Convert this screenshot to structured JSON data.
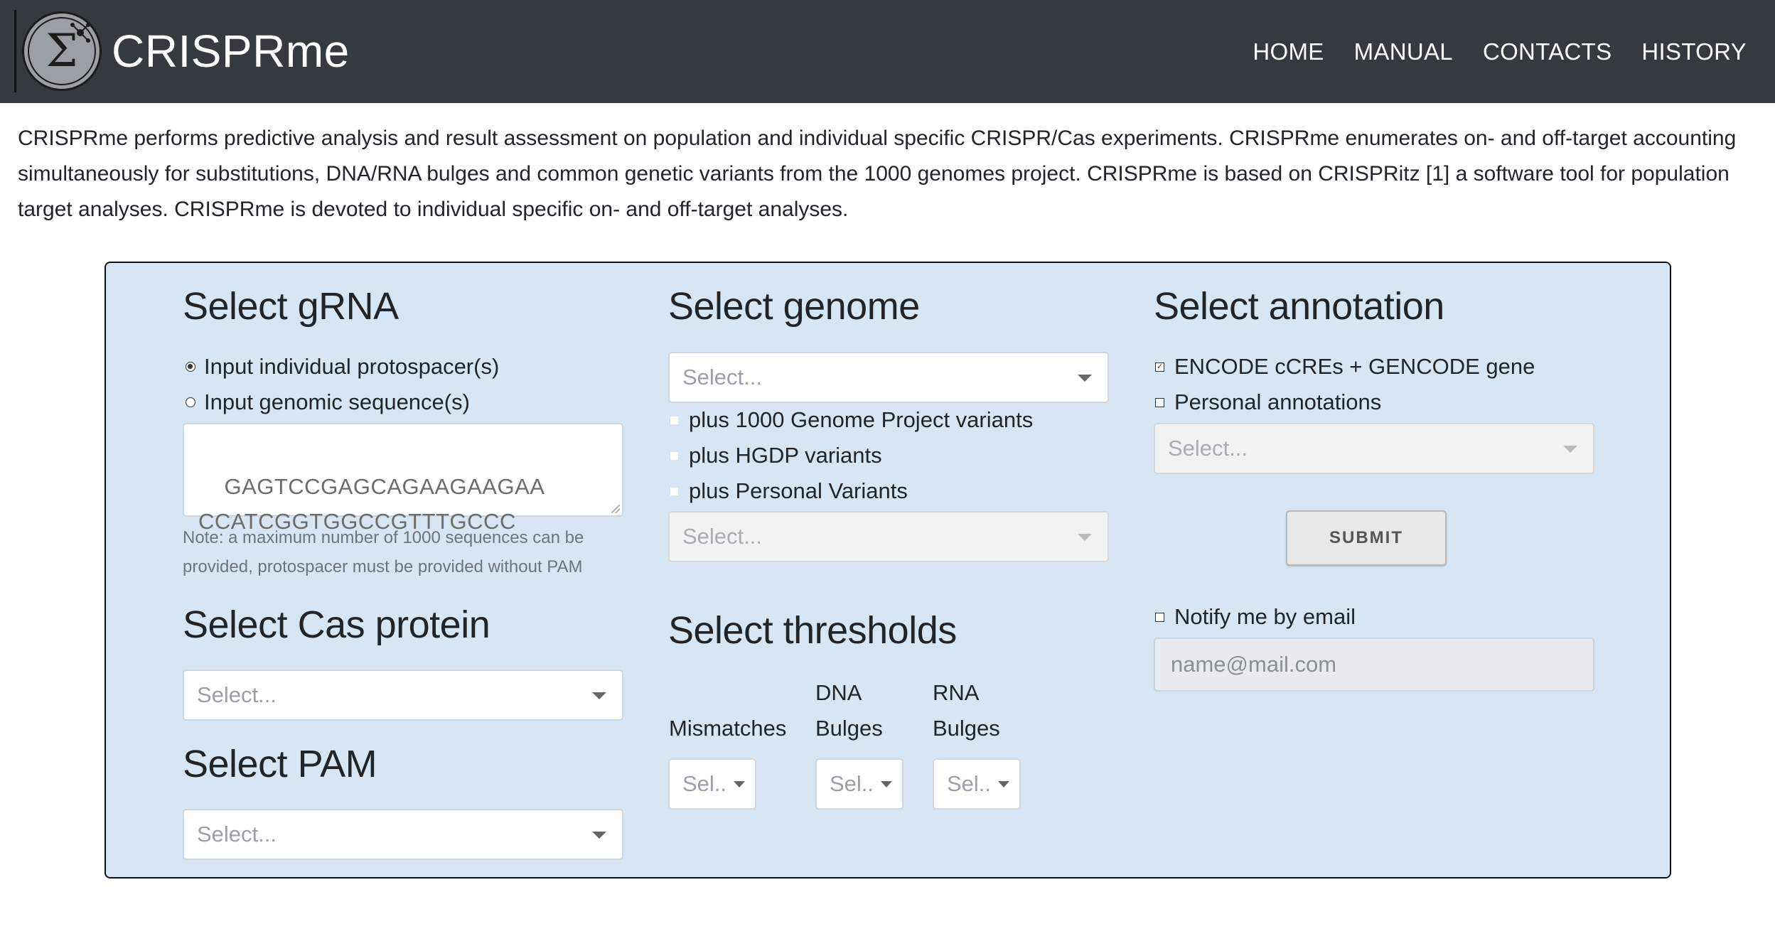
{
  "app": {
    "title": "CRISPRme"
  },
  "nav": {
    "items": [
      {
        "label": "HOME"
      },
      {
        "label": "MANUAL"
      },
      {
        "label": "CONTACTS"
      },
      {
        "label": "HISTORY"
      }
    ]
  },
  "intro": {
    "text": "CRISPRme performs predictive analysis and result assessment on population and individual specific CRISPR/Cas experiments. CRISPRme enumerates on- and off-target accounting simultaneously for substitutions, DNA/RNA bulges and common genetic variants from the 1000 genomes project. CRISPRme is based on CRISPRitz [1] a software tool for population target analyses. CRISPRme is devoted to individual specific on- and off-target analyses."
  },
  "grna": {
    "heading": "Select gRNA",
    "option_protospacer": "Input individual protospacer(s)",
    "option_genomic": "Input genomic sequence(s)",
    "selected_option": "protospacer",
    "sequences": "GAGTCCGAGCAGAAGAAGAA\nCCATCGGTGGCCGTTTGCCC",
    "note": "Note: a maximum number of 1000 sequences can be provided, protospacer must be provided without PAM"
  },
  "cas": {
    "heading": "Select Cas protein",
    "placeholder": "Select..."
  },
  "pam": {
    "heading": "Select PAM",
    "placeholder": "Select..."
  },
  "genome": {
    "heading": "Select genome",
    "placeholder": "Select...",
    "variants": [
      {
        "label": "plus 1000 Genome Project variants",
        "checked": false
      },
      {
        "label": "plus HGDP variants",
        "checked": false
      },
      {
        "label": "plus Personal Variants",
        "checked": false
      }
    ],
    "personal_variants_placeholder": "Select..."
  },
  "thresholds": {
    "heading": "Select thresholds",
    "mismatches_label": "Mismatches",
    "dna_bulges_label_line1": "DNA",
    "dna_bulges_label_line2": "Bulges",
    "rna_bulges_label_line1": "RNA",
    "rna_bulges_label_line2": "Bulges",
    "placeholder_short": "Sel.."
  },
  "annotation": {
    "heading": "Select annotation",
    "encode_label": "ENCODE cCREs + GENCODE gene",
    "encode_checked": true,
    "personal_label": "Personal annotations",
    "personal_checked": false,
    "personal_placeholder": "Select..."
  },
  "submit": {
    "label": "SUBMIT"
  },
  "notify": {
    "label": "Notify me by email",
    "checked": false,
    "email_placeholder": "name@mail.com"
  },
  "colors": {
    "navbar": "#343a40",
    "panel": "#d6e6f4"
  }
}
